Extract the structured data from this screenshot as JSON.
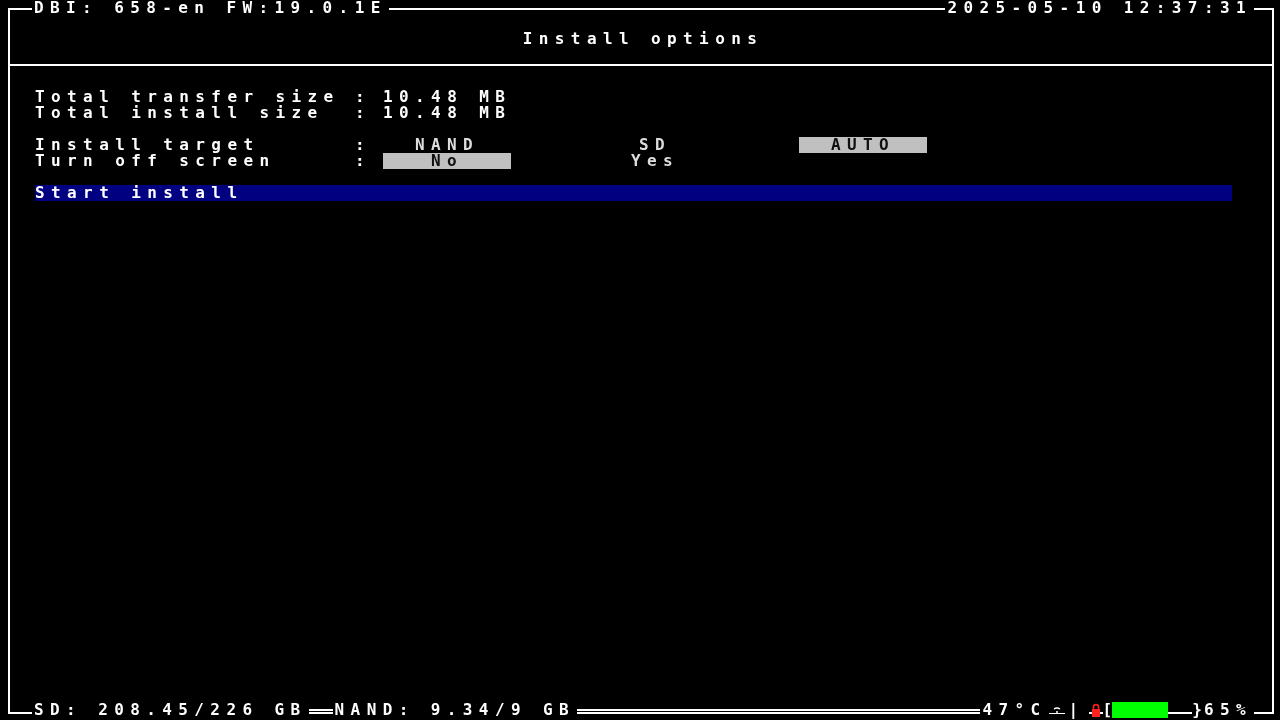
{
  "header": {
    "app_info": "DBI: 658-en FW:19.0.1E",
    "datetime": "2025-05-10 12:37:31"
  },
  "title": "Install options",
  "info": [
    {
      "label": "Total transfer size",
      "value": "10.48 MB"
    },
    {
      "label": "Total install size",
      "value": "10.48 MB"
    }
  ],
  "options": [
    {
      "label": "Install target",
      "choices": [
        {
          "label": "NAND",
          "selected": false
        },
        {
          "label": "SD",
          "selected": false
        },
        {
          "label": "AUTO",
          "selected": true
        }
      ]
    },
    {
      "label": "Turn off screen",
      "choices": [
        {
          "label": "No",
          "selected": true
        },
        {
          "label": "Yes",
          "selected": false
        }
      ]
    }
  ],
  "separator": ":",
  "actions": [
    {
      "label": "Start install",
      "selected": true
    }
  ],
  "status_bar": {
    "sd": "SD: 208.45/226 GB",
    "nand": "NAND: 9.34/9 GB",
    "temperature": "47°C",
    "divider": "|",
    "bracket_open": "[",
    "bracket_close": "}",
    "battery": "65%"
  }
}
